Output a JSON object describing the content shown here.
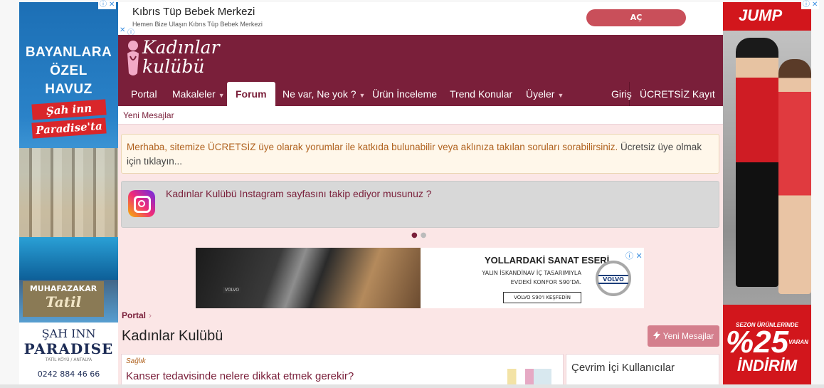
{
  "left_ad": {
    "lines": [
      "BAYANLARA",
      "ÖZEL",
      "HAVUZ"
    ],
    "script1": "Şah inn",
    "script2": "Paradise'ta",
    "badge_line1": "MUHAFAZAKAR",
    "badge_line2": "Tatil",
    "brand1": "ŞAH INN",
    "brand2": "PARADISE",
    "location": "TATİL KÖYÜ / ANTALYA",
    "phone": "0242 884 46 66"
  },
  "right_ad": {
    "brand": "JUMP",
    "sale_line1": "SEZON ÜRÜNLERİNDE",
    "sale_percent": "%25",
    "sale_varan": "VARAN",
    "sale_line3": "İNDİRİM"
  },
  "top_ad": {
    "title": "Kıbrıs Tüp Bebek Merkezi",
    "subtitle": "Hemen Bize Ulaşın Kıbrıs Tüp Bebek Merkezi",
    "button": "AÇ"
  },
  "site": {
    "logo_line1": "Kadınlar",
    "logo_line2": "kulübü",
    "nav": {
      "portal": "Portal",
      "makaleler": "Makaleler",
      "forum": "Forum",
      "nevar": "Ne var, Ne yok ?",
      "urun": "Ürün İnceleme",
      "trend": "Trend Konular",
      "uyeler": "Üyeler",
      "giris": "Giriş",
      "kayit": "ÜCRETSİZ Kayıt Ol"
    },
    "subnav": "Yeni Mesajlar",
    "notice_highlight": "Merhaba, sitemize ÜCRETSİZ üye olarak yorumlar ile katkıda bulunabilir veya aklınıza takılan soruları sorabilirsiniz.",
    "notice_rest": " Ücretsiz üye olmak için tıklayın...",
    "instagram_text": "Kadınlar Kulübü Instagram sayfasını takip ediyor musunuz ?",
    "breadcrumb": "Portal",
    "page_title": "Kadınlar Kulübü",
    "new_messages_button": "Yeni Mesajlar",
    "post_category": "Sağlık",
    "post_title": "Kanser tedavisinde nelere dikkat etmek gerekir?",
    "online_title": "Çevrim İçi Kullanıcılar"
  },
  "mid_ad": {
    "headline": "YOLLARDAKİ SANAT ESERİ",
    "line1": "YALIN İSKANDİNAV İÇ TASARIMIYLA",
    "line2": "EVDEKİ KONFOR S90'DA.",
    "button": "VOLVO S90'I KEŞFEDİN",
    "brand": "VOLVO"
  },
  "icons": {
    "adchoices": "ⓘ",
    "close": "✕",
    "arrow": "›",
    "caret": "▼"
  }
}
